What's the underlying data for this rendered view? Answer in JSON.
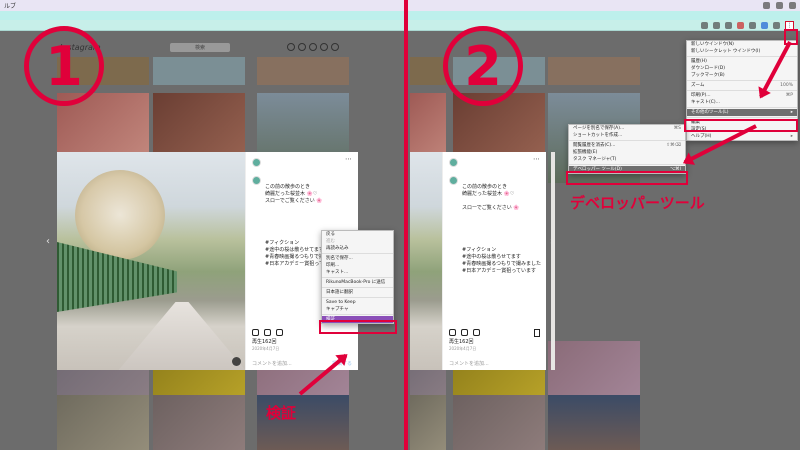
{
  "menubar": {
    "app": "ルブ"
  },
  "panel1": {
    "search_placeholder": "検索",
    "caption_lines": [
      "この前の散歩のとき",
      "綺麗だった桜並木 🌸♡",
      "",
      "スローでご覧ください 🌸",
      "",
      "",
      "",
      "",
      "#フィクション",
      "#途中の桜は散らせてます",
      "#青春映画撮るつもりで撮みました",
      "#日本アカデミー賞狙っています"
    ],
    "likes": "再生162回",
    "date": "2020年4月7日",
    "comment_placeholder": "コメントを追加...",
    "post_button": "投稿する",
    "context_menu": {
      "items": [
        "戻る",
        "進む",
        "再読み込み",
        "",
        "別名で保存...",
        "印刷...",
        "キャスト...",
        "",
        "RikunoMacBook-Pro に送信",
        "",
        "日本語に翻訳",
        "",
        "Save to Keep",
        "キャプチャ",
        "",
        "検証"
      ]
    },
    "annotation_label": "検証",
    "badge": "1"
  },
  "panel2": {
    "caption_lines": [
      "この前の散歩のとき",
      "綺麗だった桜並木 🌸♡",
      "",
      "スローでご覧ください 🌸",
      "",
      "",
      "",
      "",
      "#フィクション",
      "#途中の桜は散らせてます",
      "#青春映画撮るつもりで撮みました",
      "#日本アカデミー賞狙っています"
    ],
    "likes": "再生162回",
    "date": "2020年4月7日",
    "comment_placeholder": "コメントを追加...",
    "chrome_menu": {
      "items": [
        "新しいウインドウ(N)",
        "新しいシークレット ウインドウ(I)",
        "",
        "履歴(H)",
        "ダウンロード(D)",
        "ブックマーク(B)",
        "",
        "ズーム",
        "",
        "印刷(P)...",
        "キャスト(C)...",
        "",
        "その他のツール(L)",
        "",
        "編集",
        "設定(S)",
        "ヘルプ(H)"
      ],
      "shortcuts": [
        "",
        "",
        "",
        "",
        "",
        "",
        "",
        "100%",
        "",
        "⌘P",
        "",
        "",
        "▸",
        "",
        "",
        "",
        "▸"
      ]
    },
    "submenu": {
      "items": [
        "ページを別名で保存(A)...",
        "ショートカットを作成...",
        "",
        "閲覧履歴を消去(C)...",
        "拡張機能(E)",
        "タスク マネージャ(T)",
        "",
        "デベロッパー ツール(D)"
      ],
      "shortcuts": [
        "⌘S",
        "",
        "",
        "⇧⌘⌫",
        "",
        "",
        "",
        "⌥⌘I"
      ]
    },
    "annotation_label": "デベロッパーツール",
    "badge": "2"
  }
}
